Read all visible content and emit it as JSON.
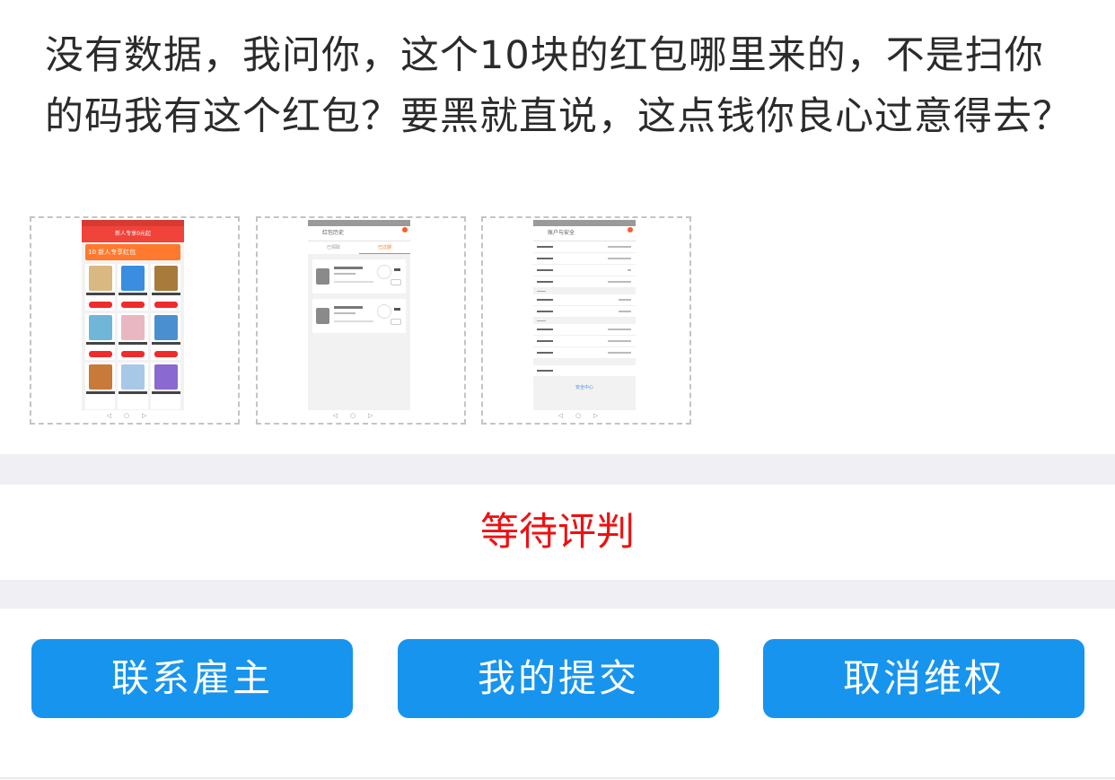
{
  "message": "没有数据，我问你，这个10块的红包哪里来的，不是扫你的码我有这个红包？要黑就直说，这点钱你良心过意得去？",
  "thumbnails": [
    {
      "header": "新人专享0元起",
      "banner": "10 新人专享红包",
      "tabs": []
    },
    {
      "header": "红包历史",
      "banner": "",
      "tabs": [
        "已领取",
        "已过期"
      ]
    },
    {
      "header": "账户与安全",
      "banner": "",
      "tabs": [],
      "footer": "安全中心"
    }
  ],
  "status": "等待评判",
  "actions": {
    "contact": "联系雇主",
    "my_submission": "我的提交",
    "cancel": "取消维权"
  },
  "colors": {
    "accent": "#1794ee",
    "status": "#ee1111",
    "divider": "#efeff4"
  }
}
